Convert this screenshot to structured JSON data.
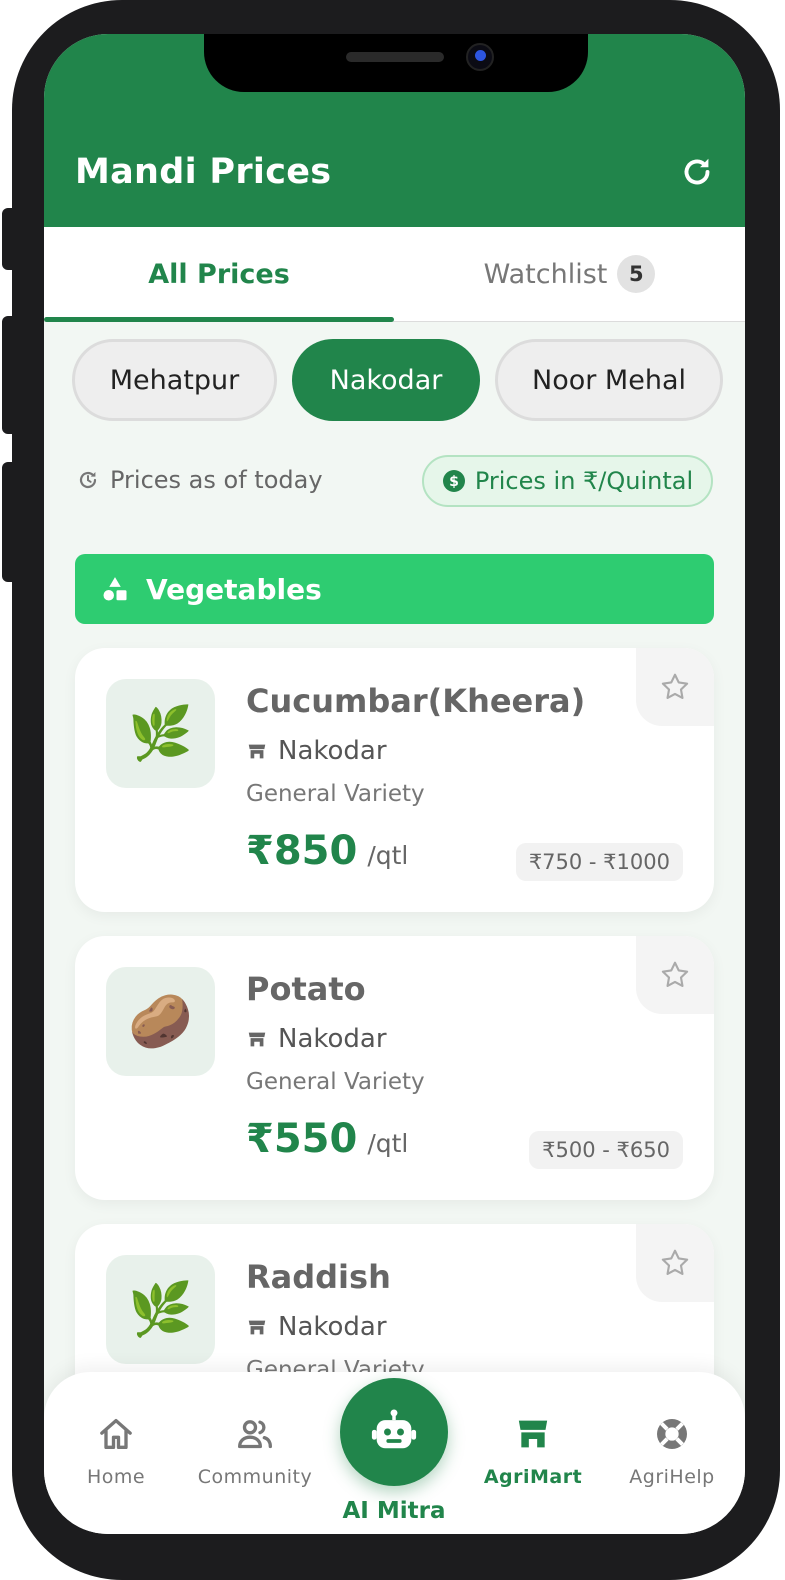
{
  "header": {
    "title": "Mandi Prices"
  },
  "tabs": {
    "all_prices": "All Prices",
    "watchlist": "Watchlist",
    "watchlist_count": "5"
  },
  "markets": [
    "Mehatpur",
    "Nakodar",
    "Noor Mehal"
  ],
  "selected_market": "Nakodar",
  "info": {
    "as_of": "Prices as of today",
    "unit": "Prices in ₹/Quintal"
  },
  "category": {
    "name": "Vegetables"
  },
  "crops": [
    {
      "name": "Cucumbar(Kheera)",
      "market": "Nakodar",
      "variety": "General Variety",
      "price": "₹850",
      "unit": "/qtl",
      "range": "₹750 - ₹1000",
      "icon": "🌿"
    },
    {
      "name": "Potato",
      "market": "Nakodar",
      "variety": "General Variety",
      "price": "₹550",
      "unit": "/qtl",
      "range": "₹500 - ₹650",
      "icon": "🥔"
    },
    {
      "name": "Raddish",
      "market": "Nakodar",
      "variety": "General Variety",
      "icon": "🌿"
    }
  ],
  "nav": {
    "home": "Home",
    "community": "Community",
    "ai_mitra": "AI Mitra",
    "agrimart": "AgriMart",
    "agrihelp": "AgriHelp",
    "active": "AgriMart"
  },
  "colors": {
    "primary": "#21854b",
    "category_bar": "#2ecc71"
  }
}
